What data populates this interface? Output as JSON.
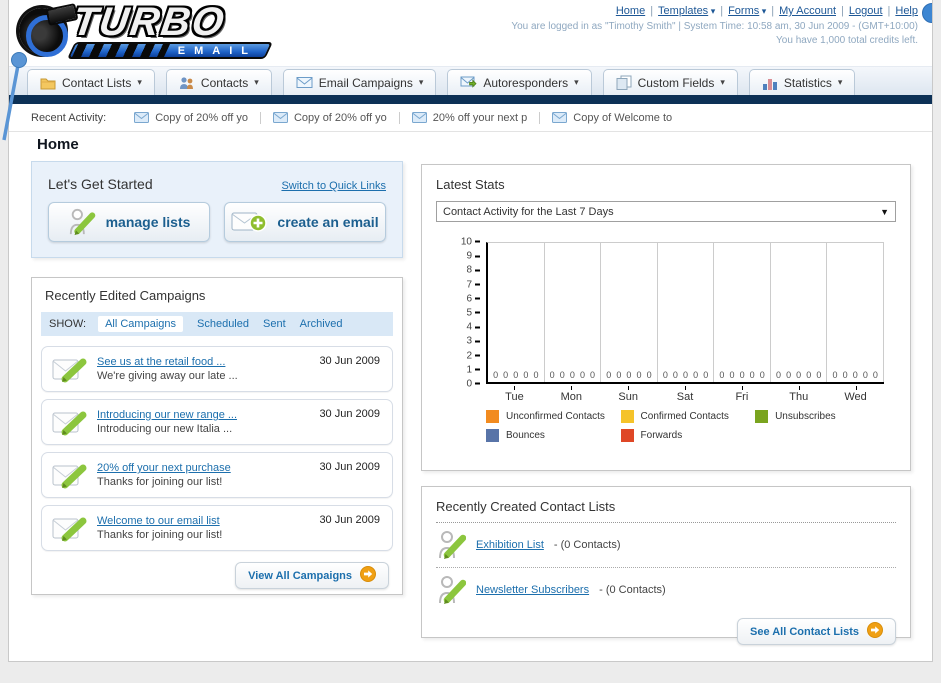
{
  "header": {
    "logo": {
      "title": "TURBO",
      "subtitle": "EMAIL"
    },
    "nav": [
      {
        "label": "Home",
        "dropdown": false
      },
      {
        "label": "Templates",
        "dropdown": true
      },
      {
        "label": "Forms",
        "dropdown": true
      },
      {
        "label": "My Account",
        "dropdown": false
      },
      {
        "label": "Logout",
        "dropdown": false
      },
      {
        "label": "Help",
        "dropdown": false
      }
    ],
    "login_info": "You are logged in as \"Timothy Smith\" | System Time: 10:58 am, 30 Jun 2009 - (GMT+10:00)",
    "credits_info": "You have 1,000 total credits left."
  },
  "tabs": [
    {
      "label": "Contact Lists",
      "icon": "contact-lists-icon"
    },
    {
      "label": "Contacts",
      "icon": "contacts-icon"
    },
    {
      "label": "Email Campaigns",
      "icon": "email-campaigns-icon"
    },
    {
      "label": "Autoresponders",
      "icon": "autoresponders-icon"
    },
    {
      "label": "Custom Fields",
      "icon": "custom-fields-icon"
    },
    {
      "label": "Statistics",
      "icon": "statistics-icon"
    }
  ],
  "recent_activity": {
    "label": "Recent Activity:",
    "items": [
      "Copy of 20% off yo",
      "Copy of 20% off yo",
      "20% off your next p",
      "Copy of Welcome to"
    ]
  },
  "page_title": "Home",
  "get_started": {
    "title": "Let's Get Started",
    "switch_link": "Switch to Quick Links",
    "buttons": [
      {
        "label": "manage lists",
        "icon": "manage-lists-icon"
      },
      {
        "label": "create an email",
        "icon": "create-email-icon"
      }
    ]
  },
  "campaigns": {
    "title": "Recently Edited Campaigns",
    "show_label": "SHOW:",
    "filters": [
      {
        "label": "All Campaigns",
        "active": true
      },
      {
        "label": "Scheduled",
        "active": false
      },
      {
        "label": "Sent",
        "active": false
      },
      {
        "label": "Archived",
        "active": false
      }
    ],
    "items": [
      {
        "title": "See us at the retail food ...",
        "subtitle": "We're giving away our late ...",
        "date": "30 Jun 2009"
      },
      {
        "title": "Introducing our new range ...",
        "subtitle": "Introducing our new Italia ...",
        "date": "30 Jun 2009"
      },
      {
        "title": "20% off your next purchase",
        "subtitle": "Thanks for joining our list!",
        "date": "30 Jun 2009"
      },
      {
        "title": "Welcome to our email list",
        "subtitle": "Thanks for joining our list!",
        "date": "30 Jun 2009"
      }
    ],
    "view_all_label": "View All Campaigns"
  },
  "stats": {
    "title": "Latest Stats",
    "dropdown_value": "Contact Activity for the Last 7 Days"
  },
  "chart_data": {
    "type": "bar",
    "title": "Contact Activity for the Last 7 Days",
    "categories": [
      "Tue",
      "Mon",
      "Sun",
      "Sat",
      "Fri",
      "Thu",
      "Wed"
    ],
    "series": [
      {
        "name": "Unconfirmed Contacts",
        "color": "#F28B1F",
        "values": [
          0,
          0,
          0,
          0,
          0,
          0,
          0
        ]
      },
      {
        "name": "Confirmed Contacts",
        "color": "#F5C32A",
        "values": [
          0,
          0,
          0,
          0,
          0,
          0,
          0
        ]
      },
      {
        "name": "Unsubscribes",
        "color": "#7AA41F",
        "values": [
          0,
          0,
          0,
          0,
          0,
          0,
          0
        ]
      },
      {
        "name": "Bounces",
        "color": "#5874A8",
        "values": [
          0,
          0,
          0,
          0,
          0,
          0,
          0
        ]
      },
      {
        "name": "Forwards",
        "color": "#DF4726",
        "values": [
          0,
          0,
          0,
          0,
          0,
          0,
          0
        ]
      }
    ],
    "ylim": [
      0,
      10
    ],
    "ytick_step": 1,
    "grid": "vertical",
    "legend_position": "bottom"
  },
  "contact_lists": {
    "title": "Recently Created Contact Lists",
    "items": [
      {
        "name": "Exhibition List",
        "detail": " - (0 Contacts)"
      },
      {
        "name": "Newsletter Subscribers",
        "detail": " - (0 Contacts)"
      }
    ],
    "see_all_label": "See All Contact Lists"
  }
}
